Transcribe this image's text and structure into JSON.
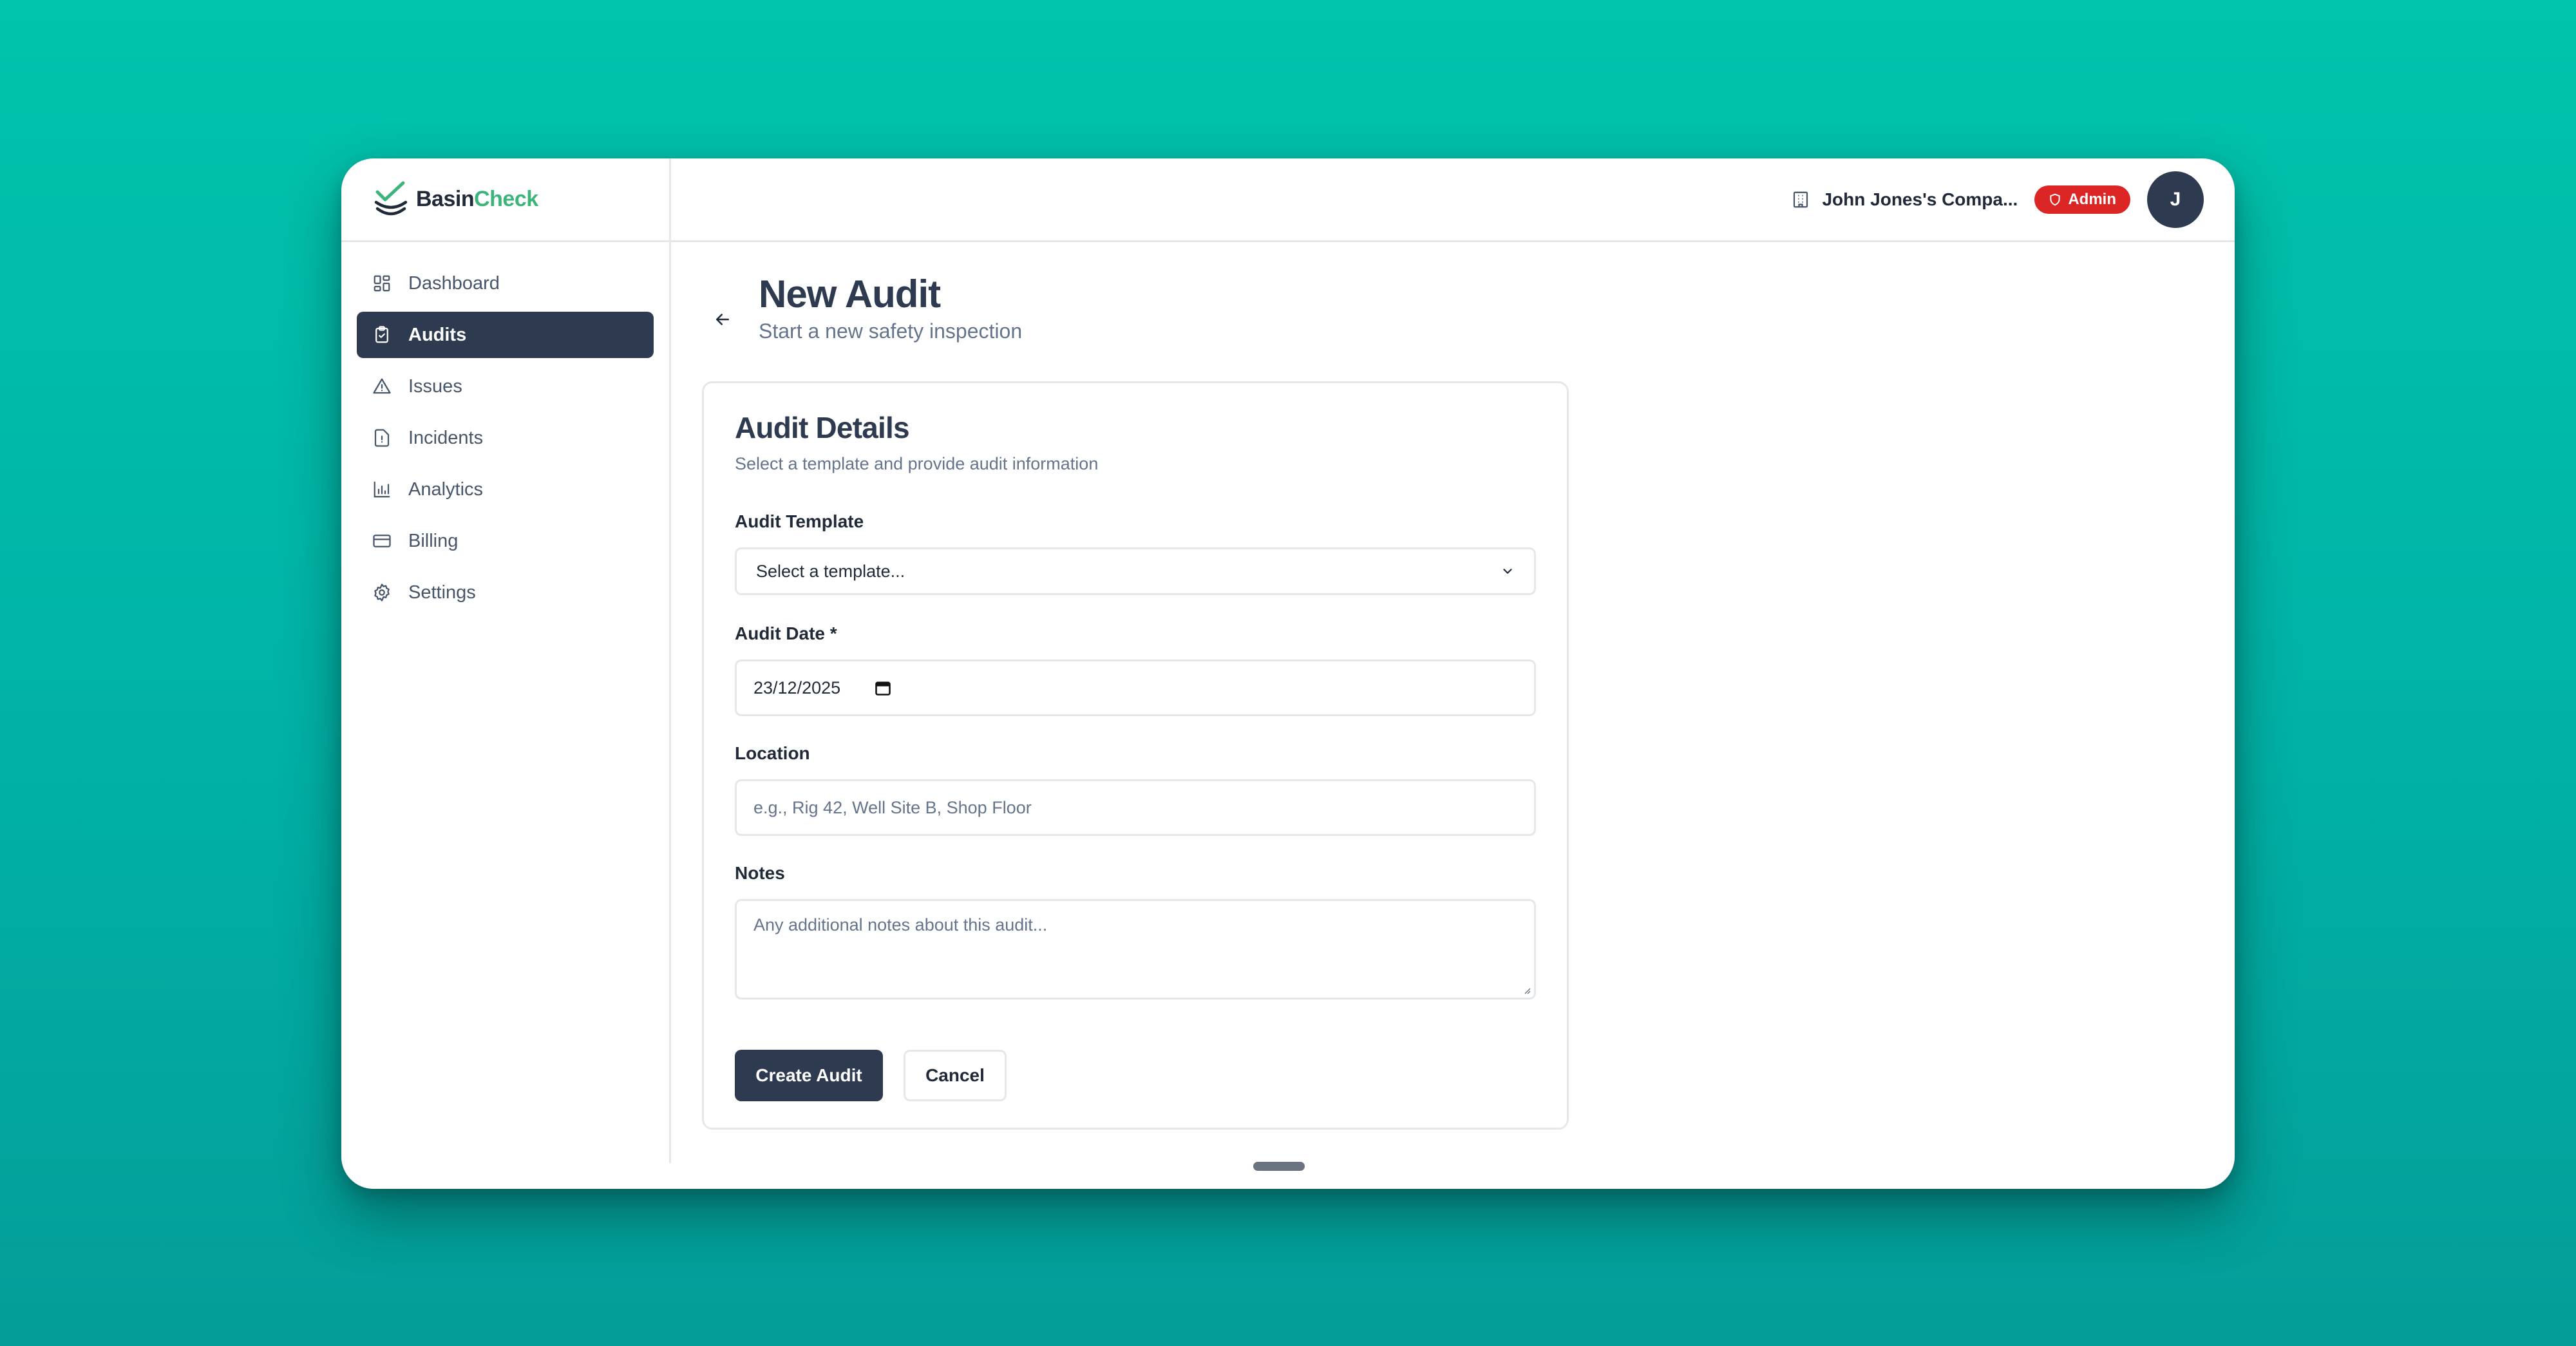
{
  "brand": {
    "name_part1": "Basin",
    "name_part2": "Check",
    "accent_color": "#3cb47c"
  },
  "sidebar": {
    "items": [
      {
        "label": "Dashboard",
        "icon": "dashboard-icon",
        "active": false
      },
      {
        "label": "Audits",
        "icon": "clipboard-check-icon",
        "active": true
      },
      {
        "label": "Issues",
        "icon": "warning-triangle-icon",
        "active": false
      },
      {
        "label": "Incidents",
        "icon": "alert-file-icon",
        "active": false
      },
      {
        "label": "Analytics",
        "icon": "bar-chart-icon",
        "active": false
      },
      {
        "label": "Billing",
        "icon": "credit-card-icon",
        "active": false
      },
      {
        "label": "Settings",
        "icon": "gear-icon",
        "active": false
      }
    ]
  },
  "topbar": {
    "company": "John Jones's Compa...",
    "company_icon": "building-icon",
    "role_badge": "Admin",
    "role_badge_color": "#dc2626",
    "avatar_initial": "J"
  },
  "page": {
    "title": "New Audit",
    "subtitle": "Start a new safety inspection"
  },
  "form": {
    "title": "Audit Details",
    "subtitle": "Select a template and provide audit information",
    "template": {
      "label": "Audit Template",
      "value": "Select a template..."
    },
    "date": {
      "label": "Audit Date *",
      "value": "23/12/2025"
    },
    "location": {
      "label": "Location",
      "placeholder": "e.g., Rig 42, Well Site B, Shop Floor"
    },
    "notes": {
      "label": "Notes",
      "placeholder": "Any additional notes about this audit..."
    },
    "submit_label": "Create Audit",
    "cancel_label": "Cancel"
  },
  "colors": {
    "primary": "#2d3a4f",
    "background_gradient_top": "#00c4ac",
    "background_gradient_bottom": "#049d98"
  }
}
